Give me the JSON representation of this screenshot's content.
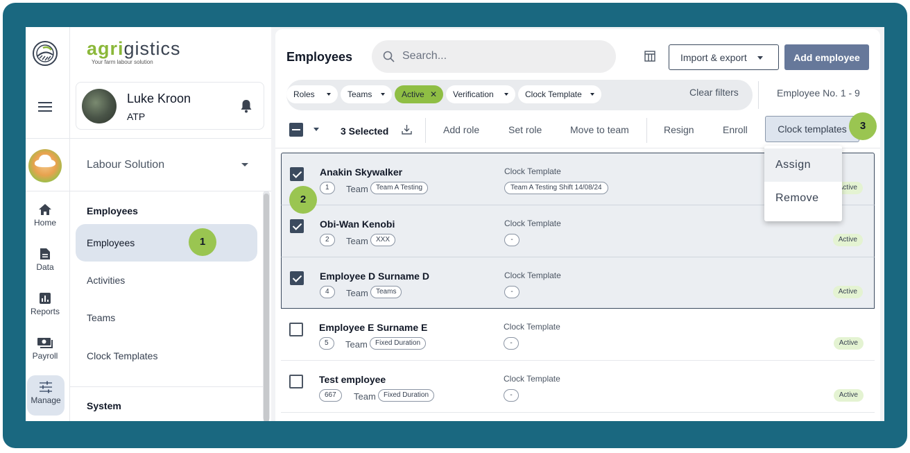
{
  "brand": {
    "name_part1": "agri",
    "name_part2": "gistics",
    "tagline": "Your farm labour solution"
  },
  "user": {
    "name": "Luke Kroon",
    "org": "ATP"
  },
  "org_selector": {
    "value": "Labour Solution"
  },
  "rail": [
    {
      "label": "Home",
      "icon": "home-icon"
    },
    {
      "label": "Data",
      "icon": "document-icon"
    },
    {
      "label": "Reports",
      "icon": "bar-chart-icon"
    },
    {
      "label": "Payroll",
      "icon": "cash-icon"
    },
    {
      "label": "Manage",
      "icon": "sliders-icon"
    }
  ],
  "sidebar": {
    "section_employees": "Employees",
    "items": [
      "Employees",
      "Activities",
      "Teams",
      "Clock Templates"
    ],
    "section_system": "System"
  },
  "header": {
    "title": "Employees",
    "search_placeholder": "Search...",
    "import_export": "Import & export",
    "add_employee": "Add employee"
  },
  "filters": {
    "chips": [
      "Roles",
      "Teams",
      "Active",
      "Verification",
      "Clock Template"
    ],
    "clear": "Clear filters",
    "count": "Employee No. 1 - 9"
  },
  "toolbar": {
    "selected": "3 Selected",
    "actions": [
      "Add role",
      "Set role",
      "Move to team",
      "Resign",
      "Enroll"
    ],
    "clock_templates": "Clock templates"
  },
  "dropdown": {
    "items": [
      "Assign",
      "Remove"
    ]
  },
  "columns": {
    "team": "Team",
    "clock_template": "Clock Template"
  },
  "employees": [
    {
      "name": "Anakin Skywalker",
      "id": "1",
      "team": "Team A Testing",
      "clock_template": "Team A Testing Shift 14/08/24",
      "status": "Active",
      "selected": true
    },
    {
      "name": "Obi-Wan Kenobi",
      "id": "2",
      "team": "XXX",
      "clock_template": "-",
      "status": "Active",
      "selected": true
    },
    {
      "name": "Employee D Surname D",
      "id": "4",
      "team": "Teams",
      "clock_template": "-",
      "status": "Active",
      "selected": true
    },
    {
      "name": "Employee E Surname E",
      "id": "5",
      "team": "Fixed Duration",
      "clock_template": "-",
      "status": "Active",
      "selected": false
    },
    {
      "name": "Test employee",
      "id": "667",
      "team": "Fixed Duration",
      "clock_template": "-",
      "status": "Active",
      "selected": false
    }
  ],
  "callouts": [
    "1",
    "2",
    "3"
  ],
  "colors": {
    "frame": "#1a6880",
    "accent_green": "#8fbe44",
    "primary": "#66789a",
    "selected_border": "#3b4a5e"
  }
}
